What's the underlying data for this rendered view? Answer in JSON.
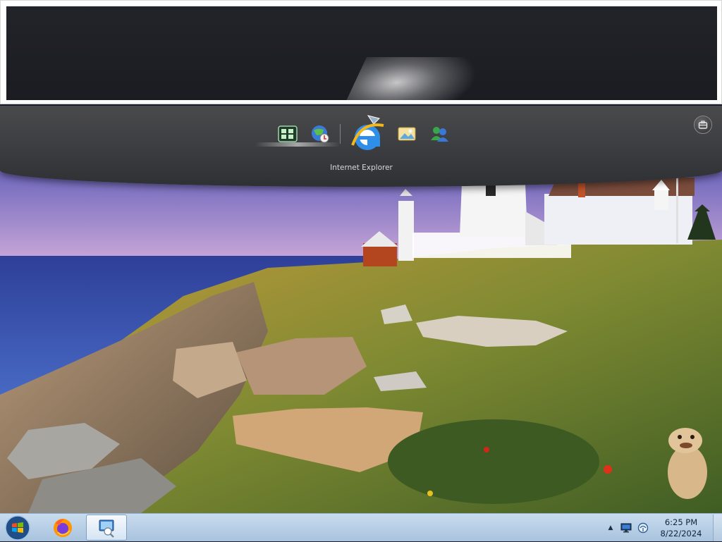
{
  "dock": {
    "items": [
      {
        "name": "multi-desktop-icon"
      },
      {
        "name": "network-globe-icon"
      },
      {
        "name": "internet-explorer-icon",
        "label": "Internet Explorer"
      },
      {
        "name": "picture-viewer-icon"
      },
      {
        "name": "messenger-icon"
      }
    ],
    "caption": "Internet Explorer"
  },
  "taskbar": {
    "start_icon": "windows-start-orb",
    "pinned": [
      {
        "name": "firefox-icon"
      },
      {
        "name": "remote-desktop-icon",
        "active": true
      }
    ],
    "tray": {
      "arrow": "▲",
      "icons": [
        "monitor-icon",
        "network-icon"
      ]
    },
    "clock": {
      "time": "6:25 PM",
      "date": "8/22/2024"
    }
  },
  "colors": {
    "taskbar": "#b8cfe6",
    "dock": "#3e3f42",
    "sky": "#6e6fc0",
    "ocean": "#2f4aa0"
  }
}
